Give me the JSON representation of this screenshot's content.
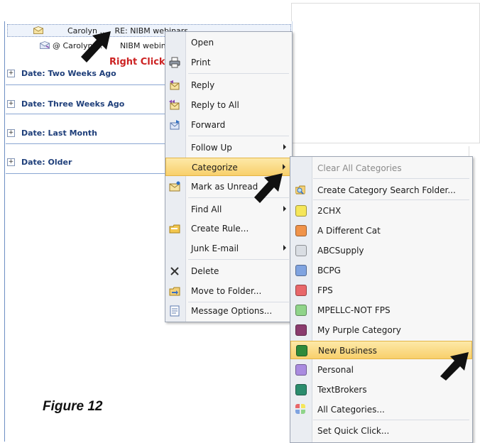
{
  "email_list": {
    "rows": [
      {
        "sender": "Carolyn ...",
        "subject": "RE: NIBM webinars"
      },
      {
        "sender": "@ Carolyn ...",
        "subject": "NIBM webina"
      }
    ],
    "groups": [
      "Date: Two Weeks Ago",
      "Date: Three Weeks Ago",
      "Date: Last Month",
      "Date: Older"
    ]
  },
  "annotation": {
    "right_click": "Right Click",
    "figure": "Figure 12"
  },
  "context_menu": {
    "items": [
      {
        "label": "Open",
        "icon": "none",
        "submenu": false
      },
      {
        "label": "Print",
        "icon": "printer-icon",
        "submenu": false
      },
      {
        "label": "Reply",
        "icon": "reply-icon",
        "submenu": false
      },
      {
        "label": "Reply to All",
        "icon": "reply-all-icon",
        "submenu": false
      },
      {
        "label": "Forward",
        "icon": "forward-icon",
        "submenu": false
      },
      {
        "label": "Follow Up",
        "icon": "none",
        "submenu": true
      },
      {
        "label": "Categorize",
        "icon": "none",
        "submenu": true,
        "highlighted": true
      },
      {
        "label": "Mark as Unread",
        "icon": "envelope-icon",
        "submenu": false
      },
      {
        "label": "Find All",
        "icon": "none",
        "submenu": true
      },
      {
        "label": "Create Rule...",
        "icon": "rule-icon",
        "submenu": false
      },
      {
        "label": "Junk E-mail",
        "icon": "none",
        "submenu": true
      },
      {
        "label": "Delete",
        "icon": "delete-icon",
        "submenu": false
      },
      {
        "label": "Move to Folder...",
        "icon": "move-folder-icon",
        "submenu": false
      },
      {
        "label": "Message Options...",
        "icon": "options-icon",
        "submenu": false
      }
    ]
  },
  "categorize_menu": {
    "items": [
      {
        "label": "Clear All Categories",
        "color": "",
        "disabled": true
      },
      {
        "label": "Create Category Search Folder...",
        "color": "search-folder-icon"
      },
      {
        "label": "2CHX",
        "color": "#f5e65a"
      },
      {
        "label": "A Different Cat",
        "color": "#f0934a"
      },
      {
        "label": "ABCSupply",
        "color": "#d9dde3"
      },
      {
        "label": "BCPG",
        "color": "#7fa3e0"
      },
      {
        "label": "FPS",
        "color": "#e8676a"
      },
      {
        "label": "MPELLC-NOT FPS",
        "color": "#8fd48a"
      },
      {
        "label": "My Purple Category",
        "color": "#8a3b6e"
      },
      {
        "label": "New Business",
        "color": "#2f8a3a",
        "highlighted": true
      },
      {
        "label": "Personal",
        "color": "#a98be0"
      },
      {
        "label": "TextBrokers",
        "color": "#2a8c6e"
      },
      {
        "label": "All Categories...",
        "color": "all-categories-icon"
      },
      {
        "label": "Set Quick Click...",
        "color": ""
      }
    ]
  },
  "colors": {
    "highlight": "#f8cf6b",
    "group_text": "#1f3f7a",
    "annotation_red": "#cc2222"
  }
}
